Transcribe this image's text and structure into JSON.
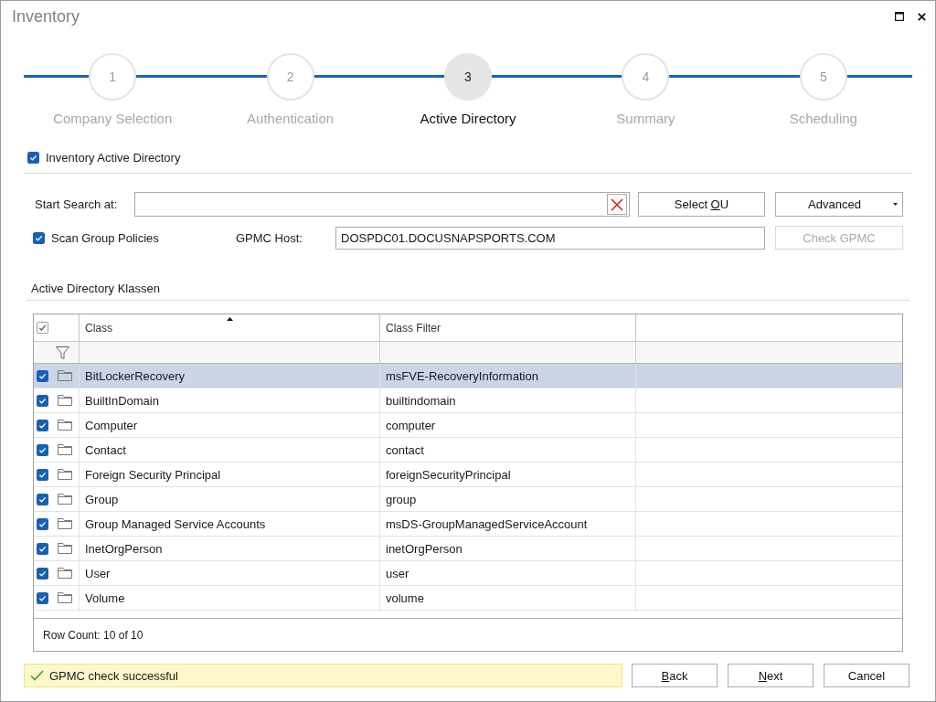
{
  "window": {
    "title": "Inventory"
  },
  "steps": [
    {
      "number": "1",
      "label": "Company Selection",
      "selected": false
    },
    {
      "number": "2",
      "label": "Authentication",
      "selected": false
    },
    {
      "number": "3",
      "label": "Active Directory",
      "selected": true
    },
    {
      "number": "4",
      "label": "Summary",
      "selected": false
    },
    {
      "number": "5",
      "label": "Scheduling",
      "selected": false
    }
  ],
  "inventory_active_directory": {
    "label": "Inventory Active Directory",
    "checked": true
  },
  "search": {
    "start_search": {
      "label": "Start Search at:"
    },
    "select_ou_button": {
      "label": [
        {
          "text": "Select ",
          "access_key": false
        },
        {
          "text": "O",
          "access_key": true
        },
        {
          "text": "U",
          "access_key": false
        }
      ],
      "disabled": false
    },
    "advanced_button": {
      "label": [
        {
          "text": "Advanced",
          "access_key": false
        }
      ],
      "disabled": false,
      "dropdown": true
    },
    "scan_group_policies": {
      "label": "Scan Group Policies",
      "checked": true
    },
    "gpmc_host": {
      "label": "GPMC Host:",
      "value": "DOSPDC01.DOCUSNAPSPORTS.COM"
    },
    "check_gpmc_button": {
      "label": [
        {
          "text": "Check GPMC",
          "access_key": false
        }
      ],
      "disabled": true
    }
  },
  "classes": {
    "title": "Active Directory Klassen",
    "all_checked": true,
    "columns": [
      {
        "label": "Class",
        "sorted": true
      },
      {
        "label": "Class Filter",
        "sorted": false
      }
    ],
    "rows": [
      {
        "checked": true,
        "selected": true,
        "class": "BitLockerRecovery",
        "class_filter": "msFVE-RecoveryInformation"
      },
      {
        "checked": true,
        "selected": false,
        "class": "BuiltInDomain",
        "class_filter": "builtindomain"
      },
      {
        "checked": true,
        "selected": false,
        "class": "Computer",
        "class_filter": "computer"
      },
      {
        "checked": true,
        "selected": false,
        "class": "Contact",
        "class_filter": "contact"
      },
      {
        "checked": true,
        "selected": false,
        "class": "Foreign Security Principal",
        "class_filter": "foreignSecurityPrincipal"
      },
      {
        "checked": true,
        "selected": false,
        "class": "Group",
        "class_filter": "group"
      },
      {
        "checked": true,
        "selected": false,
        "class": "Group Managed Service Accounts",
        "class_filter": "msDS-GroupManagedServiceAccount"
      },
      {
        "checked": true,
        "selected": false,
        "class": "InetOrgPerson",
        "class_filter": "inetOrgPerson"
      },
      {
        "checked": true,
        "selected": false,
        "class": "User",
        "class_filter": "user"
      },
      {
        "checked": true,
        "selected": false,
        "class": "Volume",
        "class_filter": "volume"
      }
    ],
    "row_count": "Row Count: 10 of 10"
  },
  "footer": {
    "status": {
      "kind": "success",
      "text": "GPMC check successful"
    },
    "back_button": {
      "label": [
        {
          "text": "B",
          "access_key": true
        },
        {
          "text": "ack",
          "access_key": false
        }
      ],
      "disabled": false
    },
    "next_button": {
      "label": [
        {
          "text": "N",
          "access_key": true
        },
        {
          "text": "ext",
          "access_key": false
        }
      ],
      "disabled": false
    },
    "cancel_button": {
      "label": [
        {
          "text": "Cancel",
          "access_key": false
        }
      ],
      "disabled": false
    }
  }
}
